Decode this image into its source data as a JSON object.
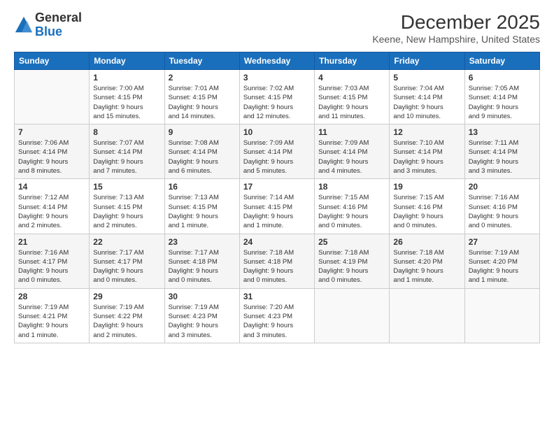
{
  "logo": {
    "general": "General",
    "blue": "Blue"
  },
  "title": "December 2025",
  "subtitle": "Keene, New Hampshire, United States",
  "days_header": [
    "Sunday",
    "Monday",
    "Tuesday",
    "Wednesday",
    "Thursday",
    "Friday",
    "Saturday"
  ],
  "weeks": [
    [
      {
        "day": "",
        "info": ""
      },
      {
        "day": "1",
        "info": "Sunrise: 7:00 AM\nSunset: 4:15 PM\nDaylight: 9 hours\nand 15 minutes."
      },
      {
        "day": "2",
        "info": "Sunrise: 7:01 AM\nSunset: 4:15 PM\nDaylight: 9 hours\nand 14 minutes."
      },
      {
        "day": "3",
        "info": "Sunrise: 7:02 AM\nSunset: 4:15 PM\nDaylight: 9 hours\nand 12 minutes."
      },
      {
        "day": "4",
        "info": "Sunrise: 7:03 AM\nSunset: 4:15 PM\nDaylight: 9 hours\nand 11 minutes."
      },
      {
        "day": "5",
        "info": "Sunrise: 7:04 AM\nSunset: 4:14 PM\nDaylight: 9 hours\nand 10 minutes."
      },
      {
        "day": "6",
        "info": "Sunrise: 7:05 AM\nSunset: 4:14 PM\nDaylight: 9 hours\nand 9 minutes."
      }
    ],
    [
      {
        "day": "7",
        "info": "Sunrise: 7:06 AM\nSunset: 4:14 PM\nDaylight: 9 hours\nand 8 minutes."
      },
      {
        "day": "8",
        "info": "Sunrise: 7:07 AM\nSunset: 4:14 PM\nDaylight: 9 hours\nand 7 minutes."
      },
      {
        "day": "9",
        "info": "Sunrise: 7:08 AM\nSunset: 4:14 PM\nDaylight: 9 hours\nand 6 minutes."
      },
      {
        "day": "10",
        "info": "Sunrise: 7:09 AM\nSunset: 4:14 PM\nDaylight: 9 hours\nand 5 minutes."
      },
      {
        "day": "11",
        "info": "Sunrise: 7:09 AM\nSunset: 4:14 PM\nDaylight: 9 hours\nand 4 minutes."
      },
      {
        "day": "12",
        "info": "Sunrise: 7:10 AM\nSunset: 4:14 PM\nDaylight: 9 hours\nand 3 minutes."
      },
      {
        "day": "13",
        "info": "Sunrise: 7:11 AM\nSunset: 4:14 PM\nDaylight: 9 hours\nand 3 minutes."
      }
    ],
    [
      {
        "day": "14",
        "info": "Sunrise: 7:12 AM\nSunset: 4:14 PM\nDaylight: 9 hours\nand 2 minutes."
      },
      {
        "day": "15",
        "info": "Sunrise: 7:13 AM\nSunset: 4:15 PM\nDaylight: 9 hours\nand 2 minutes."
      },
      {
        "day": "16",
        "info": "Sunrise: 7:13 AM\nSunset: 4:15 PM\nDaylight: 9 hours\nand 1 minute."
      },
      {
        "day": "17",
        "info": "Sunrise: 7:14 AM\nSunset: 4:15 PM\nDaylight: 9 hours\nand 1 minute."
      },
      {
        "day": "18",
        "info": "Sunrise: 7:15 AM\nSunset: 4:16 PM\nDaylight: 9 hours\nand 0 minutes."
      },
      {
        "day": "19",
        "info": "Sunrise: 7:15 AM\nSunset: 4:16 PM\nDaylight: 9 hours\nand 0 minutes."
      },
      {
        "day": "20",
        "info": "Sunrise: 7:16 AM\nSunset: 4:16 PM\nDaylight: 9 hours\nand 0 minutes."
      }
    ],
    [
      {
        "day": "21",
        "info": "Sunrise: 7:16 AM\nSunset: 4:17 PM\nDaylight: 9 hours\nand 0 minutes."
      },
      {
        "day": "22",
        "info": "Sunrise: 7:17 AM\nSunset: 4:17 PM\nDaylight: 9 hours\nand 0 minutes."
      },
      {
        "day": "23",
        "info": "Sunrise: 7:17 AM\nSunset: 4:18 PM\nDaylight: 9 hours\nand 0 minutes."
      },
      {
        "day": "24",
        "info": "Sunrise: 7:18 AM\nSunset: 4:18 PM\nDaylight: 9 hours\nand 0 minutes."
      },
      {
        "day": "25",
        "info": "Sunrise: 7:18 AM\nSunset: 4:19 PM\nDaylight: 9 hours\nand 0 minutes."
      },
      {
        "day": "26",
        "info": "Sunrise: 7:18 AM\nSunset: 4:20 PM\nDaylight: 9 hours\nand 1 minute."
      },
      {
        "day": "27",
        "info": "Sunrise: 7:19 AM\nSunset: 4:20 PM\nDaylight: 9 hours\nand 1 minute."
      }
    ],
    [
      {
        "day": "28",
        "info": "Sunrise: 7:19 AM\nSunset: 4:21 PM\nDaylight: 9 hours\nand 1 minute."
      },
      {
        "day": "29",
        "info": "Sunrise: 7:19 AM\nSunset: 4:22 PM\nDaylight: 9 hours\nand 2 minutes."
      },
      {
        "day": "30",
        "info": "Sunrise: 7:19 AM\nSunset: 4:23 PM\nDaylight: 9 hours\nand 3 minutes."
      },
      {
        "day": "31",
        "info": "Sunrise: 7:20 AM\nSunset: 4:23 PM\nDaylight: 9 hours\nand 3 minutes."
      },
      {
        "day": "",
        "info": ""
      },
      {
        "day": "",
        "info": ""
      },
      {
        "day": "",
        "info": ""
      }
    ]
  ]
}
